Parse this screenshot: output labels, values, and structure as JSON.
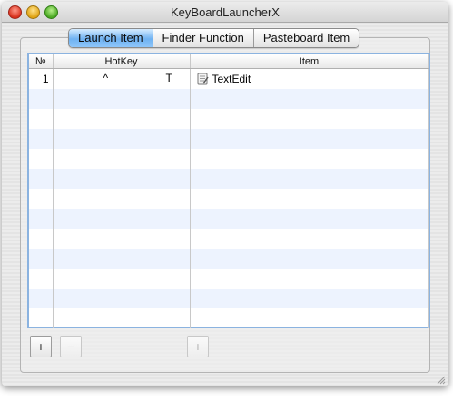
{
  "window": {
    "title": "KeyBoardLauncherX"
  },
  "tabs": [
    {
      "label": "Launch Item",
      "active": true
    },
    {
      "label": "Finder Function",
      "active": false
    },
    {
      "label": "Pasteboard Item",
      "active": false
    }
  ],
  "table": {
    "columns": [
      "№",
      "HotKey",
      "Item"
    ],
    "rows": [
      {
        "num": "1",
        "modifier": "^",
        "key": "T",
        "item": "TextEdit",
        "item_icon": "textedit-app-icon"
      }
    ]
  },
  "buttons": {
    "add_label": "+",
    "remove_label": "−",
    "add_item_label": "+"
  },
  "colors": {
    "tab_active": "#6fb2f2",
    "row_stripe": "#edf3fe",
    "table_border": "#8bb3e0"
  }
}
